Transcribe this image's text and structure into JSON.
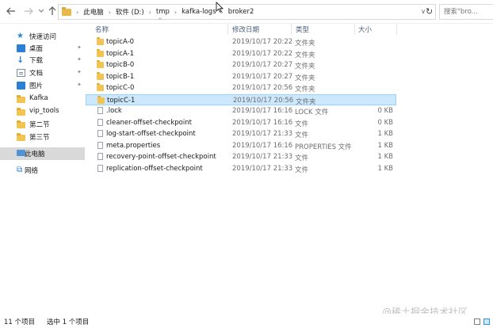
{
  "address_bar": {
    "breadcrumbs": [
      "此电脑",
      "软件 (D:)",
      "tmp",
      "kafka-logs",
      "broker2"
    ],
    "search_placeholder": "搜索\"bro..."
  },
  "nav_pane": {
    "items": [
      {
        "label": "快速访问",
        "icon": "star-icon",
        "pinned": false
      },
      {
        "label": "桌面",
        "icon": "desktop-icon",
        "pinned": true
      },
      {
        "label": "下载",
        "icon": "download-icon",
        "pinned": true
      },
      {
        "label": "文档",
        "icon": "document-icon",
        "pinned": true
      },
      {
        "label": "图片",
        "icon": "pictures-icon",
        "pinned": true
      },
      {
        "label": "Kafka",
        "icon": "folder-icon",
        "pinned": false
      },
      {
        "label": "vip_tools",
        "icon": "folder-icon",
        "pinned": false
      },
      {
        "label": "第二节",
        "icon": "folder-icon",
        "pinned": false
      },
      {
        "label": "第三节",
        "icon": "folder-icon",
        "pinned": false
      },
      {
        "label": "此电脑",
        "icon": "this-pc-icon",
        "pinned": false,
        "selected": true
      },
      {
        "label": "网络",
        "icon": "network-icon",
        "pinned": false
      }
    ]
  },
  "columns": {
    "name": "名称",
    "date": "修改日期",
    "type": "类型",
    "size": "大小"
  },
  "files": [
    {
      "name": "topicA-0",
      "date": "2019/10/17 20:22",
      "type": "文件夹",
      "size": "",
      "kind": "folder"
    },
    {
      "name": "topicA-1",
      "date": "2019/10/17 20:22",
      "type": "文件夹",
      "size": "",
      "kind": "folder"
    },
    {
      "name": "topicB-0",
      "date": "2019/10/17 20:27",
      "type": "文件夹",
      "size": "",
      "kind": "folder"
    },
    {
      "name": "topicB-1",
      "date": "2019/10/17 20:27",
      "type": "文件夹",
      "size": "",
      "kind": "folder"
    },
    {
      "name": "topicC-0",
      "date": "2019/10/17 20:56",
      "type": "文件夹",
      "size": "",
      "kind": "folder"
    },
    {
      "name": "topicC-1",
      "date": "2019/10/17 20:56",
      "type": "文件夹",
      "size": "",
      "kind": "folder",
      "selected": true
    },
    {
      "name": ".lock",
      "date": "2019/10/17 16:16",
      "type": "LOCK 文件",
      "size": "0 KB",
      "kind": "file"
    },
    {
      "name": "cleaner-offset-checkpoint",
      "date": "2019/10/17 16:16",
      "type": "文件",
      "size": "0 KB",
      "kind": "file"
    },
    {
      "name": "log-start-offset-checkpoint",
      "date": "2019/10/17 21:33",
      "type": "文件",
      "size": "1 KB",
      "kind": "file"
    },
    {
      "name": "meta.properties",
      "date": "2019/10/17 16:16",
      "type": "PROPERTIES 文件",
      "size": "1 KB",
      "kind": "file"
    },
    {
      "name": "recovery-point-offset-checkpoint",
      "date": "2019/10/17 21:33",
      "type": "文件",
      "size": "1 KB",
      "kind": "file"
    },
    {
      "name": "replication-offset-checkpoint",
      "date": "2019/10/17 21:33",
      "type": "文件",
      "size": "1 KB",
      "kind": "file"
    }
  ],
  "status_bar": {
    "item_count": "11 个项目",
    "selected_count": "选中 1 个项目"
  },
  "watermark": "@稀土掘金技术社区",
  "colors": {
    "selection_bg": "#cce8ff",
    "selection_border": "#99d1ff",
    "folder": "#f2c552",
    "accent": "#2b7fd4"
  }
}
